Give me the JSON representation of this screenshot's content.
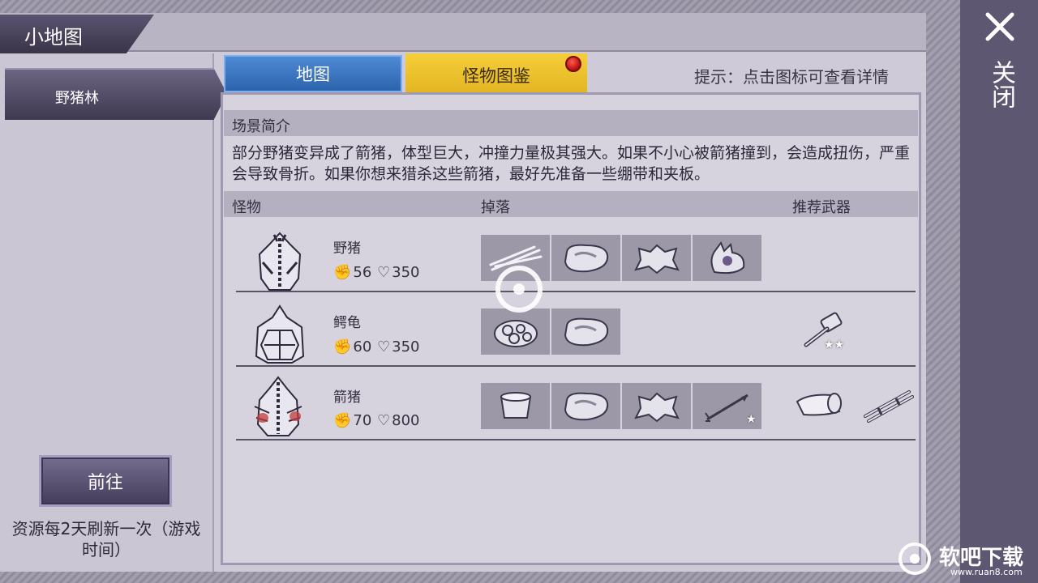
{
  "window": {
    "title": "小地图"
  },
  "sidebar": {
    "area": "野猪林",
    "goto_label": "前往",
    "refresh_note": "资源每2天刷新一次（游戏时间）"
  },
  "tabs": [
    {
      "label": "地图",
      "active": false
    },
    {
      "label": "怪物图鉴",
      "active": true,
      "has_notification": true
    }
  ],
  "hint": "提示：点击图标可查看详情",
  "scene": {
    "heading": "场景简介",
    "description": "部分野猪变异成了箭猪，体型巨大，冲撞力量极其强大。如果不小心被箭猪撞到，会造成扭伤，严重会导致骨折。如果你想来猎杀这些箭猪，最好先准备一些绷带和夹板。"
  },
  "table": {
    "headers": {
      "monster": "怪物",
      "drops": "掉落",
      "weapons": "推荐武器"
    },
    "rows": [
      {
        "name": "野猪",
        "attack": "56",
        "hp": "350",
        "drops": [
          "twigs-icon",
          "meat-icon",
          "hide-icon",
          "beast-head-icon"
        ],
        "weapons": []
      },
      {
        "name": "鳄龟",
        "attack": "60",
        "hp": "350",
        "drops": [
          "rocks-icon",
          "meat-icon"
        ],
        "weapons": [
          {
            "icon": "hammer-icon",
            "stars": "★★"
          }
        ]
      },
      {
        "name": "箭猪",
        "attack": "70",
        "hp": "800",
        "drops": [
          "bandage-roll-icon",
          "meat-icon",
          "hide-icon",
          "arrow-icon"
        ],
        "drop_stars": [
          "",
          "",
          "",
          "★"
        ],
        "weapons": [
          {
            "icon": "bandage-icon",
            "stars": ""
          },
          {
            "icon": "splint-icon",
            "stars": ""
          }
        ]
      }
    ]
  },
  "close_label": "关闭",
  "watermark": {
    "name": "软吧下载",
    "url": "www.ruan8.com"
  },
  "colors": {
    "tab_map": "#3a74c0",
    "tab_monster": "#e9bc28",
    "panel": "#cfcad8",
    "side_bar": "#5d5771"
  }
}
